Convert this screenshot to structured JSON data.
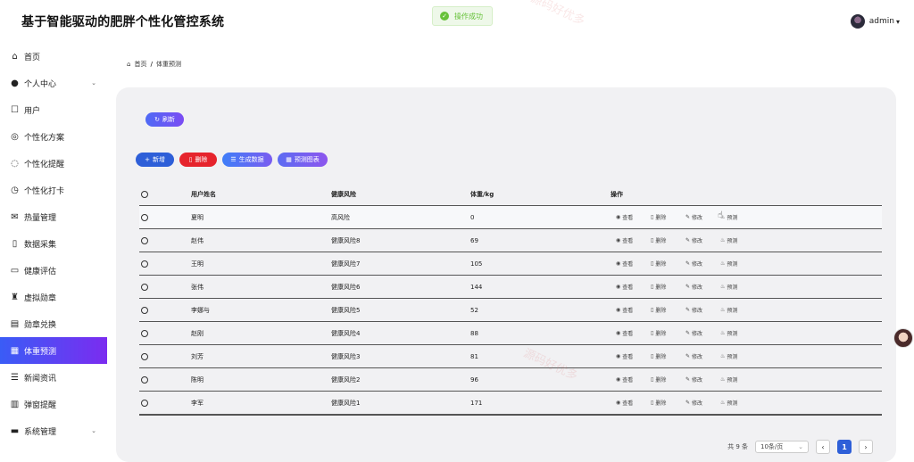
{
  "app": {
    "title": "基于智能驱动的肥胖个性化管控系统"
  },
  "toast": {
    "message": "操作成功"
  },
  "user": {
    "name": "admin"
  },
  "watermark": "源码好优多",
  "sidebar": {
    "items": [
      {
        "label": "首页",
        "icon": "home-icon",
        "glyph": "⌂"
      },
      {
        "label": "个人中心",
        "icon": "person-icon",
        "glyph": "●",
        "expandable": true
      },
      {
        "label": "用户",
        "icon": "user-icon",
        "glyph": "☐"
      },
      {
        "label": "个性化方案",
        "icon": "plan-icon",
        "glyph": "◎"
      },
      {
        "label": "个性化提醒",
        "icon": "chat-icon",
        "glyph": "◌"
      },
      {
        "label": "个性化打卡",
        "icon": "clock-icon",
        "glyph": "◷"
      },
      {
        "label": "热量管理",
        "icon": "mail-icon",
        "glyph": "✉"
      },
      {
        "label": "数据采集",
        "icon": "book-icon",
        "glyph": "▯"
      },
      {
        "label": "健康评估",
        "icon": "card-icon",
        "glyph": "▭"
      },
      {
        "label": "虚拟勋章",
        "icon": "medal-icon",
        "glyph": "♜"
      },
      {
        "label": "勋章兑换",
        "icon": "exchange-icon",
        "glyph": "▤"
      },
      {
        "label": "体重预测",
        "icon": "forecast-icon",
        "glyph": "▦",
        "active": true
      },
      {
        "label": "新闻资讯",
        "icon": "database-icon",
        "glyph": "☰"
      },
      {
        "label": "弹窗提醒",
        "icon": "calendar-icon",
        "glyph": "▥"
      },
      {
        "label": "系统管理",
        "icon": "system-icon",
        "glyph": "▬",
        "expandable": true
      }
    ]
  },
  "breadcrumb": {
    "home": "首页",
    "separator": "/",
    "current": "体重预测"
  },
  "toolbar": {
    "refresh_label": "刷新",
    "add_label": "新增",
    "delete_label": "删除",
    "generate_label": "生成数据",
    "chart_label": "预测图表"
  },
  "table": {
    "headers": {
      "name": "用户姓名",
      "risk": "健康风险",
      "weight": "体重/kg",
      "ops": "操作"
    },
    "actions": {
      "view": "查看",
      "delete": "删除",
      "edit": "修改",
      "predict": "预测"
    },
    "rows": [
      {
        "name": "夏明",
        "risk": "高风险",
        "weight": "0"
      },
      {
        "name": "赵伟",
        "risk": "健康风险8",
        "weight": "69"
      },
      {
        "name": "王明",
        "risk": "健康风险7",
        "weight": "105"
      },
      {
        "name": "张伟",
        "risk": "健康风险6",
        "weight": "144"
      },
      {
        "name": "李娜与",
        "risk": "健康风险5",
        "weight": "52"
      },
      {
        "name": "赵刚",
        "risk": "健康风险4",
        "weight": "88"
      },
      {
        "name": "刘芳",
        "risk": "健康风险3",
        "weight": "81"
      },
      {
        "name": "陈明",
        "risk": "健康风险2",
        "weight": "96"
      },
      {
        "name": "李军",
        "risk": "健康风险1",
        "weight": "171"
      }
    ]
  },
  "pagination": {
    "total": "共 9 条",
    "page_size": "10条/页",
    "current_page": "1",
    "prev": "‹",
    "next": "›"
  }
}
